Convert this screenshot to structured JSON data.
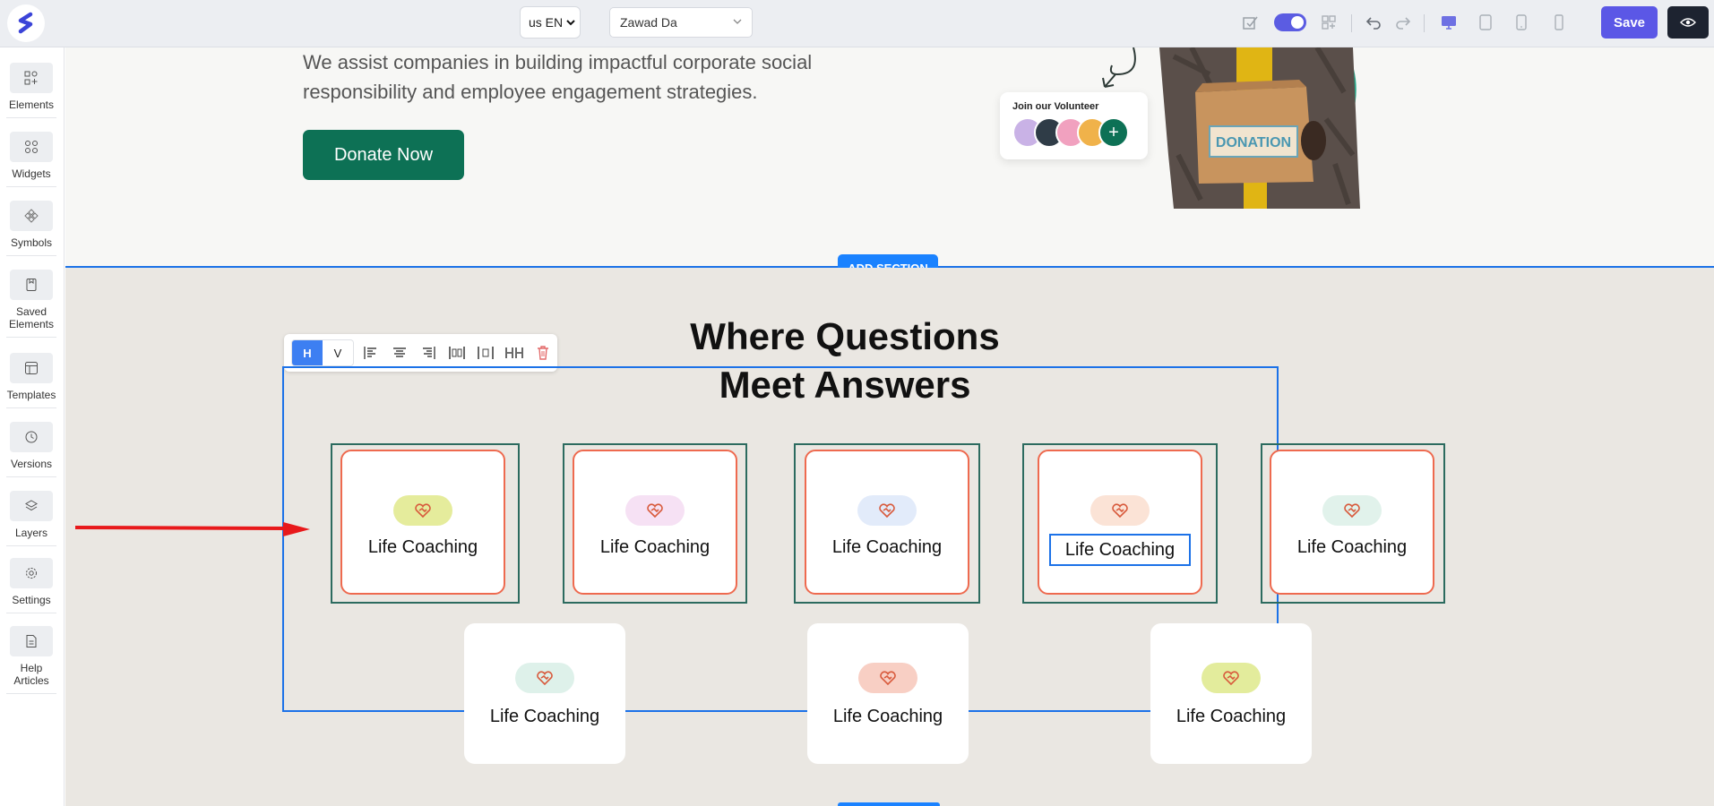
{
  "topbar": {
    "lang_label": "us EN",
    "user_label": "Zawad Da",
    "save_label": "Save"
  },
  "sidebar": {
    "items": [
      {
        "label": "Elements",
        "icon": "elements-icon"
      },
      {
        "label": "Widgets",
        "icon": "widgets-icon"
      },
      {
        "label": "Symbols",
        "icon": "symbols-icon"
      },
      {
        "label": "Saved Elements",
        "icon": "saved-elements-icon"
      },
      {
        "label": "Templates",
        "icon": "templates-icon"
      },
      {
        "label": "Versions",
        "icon": "versions-icon"
      },
      {
        "label": "Layers",
        "icon": "layers-icon"
      },
      {
        "label": "Settings",
        "icon": "settings-icon"
      },
      {
        "label": "Help Articles",
        "icon": "help-articles-icon"
      }
    ]
  },
  "hero": {
    "text_line1": "We assist companies in building impactful corporate social",
    "text_line2": "responsibility and employee engagement strategies.",
    "donate_label": "Donate Now",
    "volunteer_title": "Join our Volunteer",
    "box_label": "DONATION"
  },
  "add_section_label": "ADD SECTION",
  "faq": {
    "title_line1": "Where Questions",
    "title_line2": "Meet Answers",
    "cards": [
      {
        "label": "Life Coaching",
        "pill_color": "#e5ec9c"
      },
      {
        "label": "Life Coaching",
        "pill_color": "#f6e1f4"
      },
      {
        "label": "Life Coaching",
        "pill_color": "#e2ebfa"
      },
      {
        "label": "Life Coaching",
        "pill_color": "#fbe3d6"
      },
      {
        "label": "Life Coaching",
        "pill_color": "#e1f2eb"
      },
      {
        "label": "Life Coaching",
        "pill_color": "#def1ea"
      },
      {
        "label": "Life Coaching",
        "pill_color": "#f8cfc4"
      },
      {
        "label": "Life Coaching",
        "pill_color": "#e3ec9c"
      }
    ]
  },
  "toolbar": {
    "h_label": "H",
    "v_label": "V"
  },
  "colors": {
    "accent": "#5b57e6",
    "brand_green": "#0d7155",
    "selection_blue": "#1c72e8",
    "card_border": "#ee6a4f"
  }
}
